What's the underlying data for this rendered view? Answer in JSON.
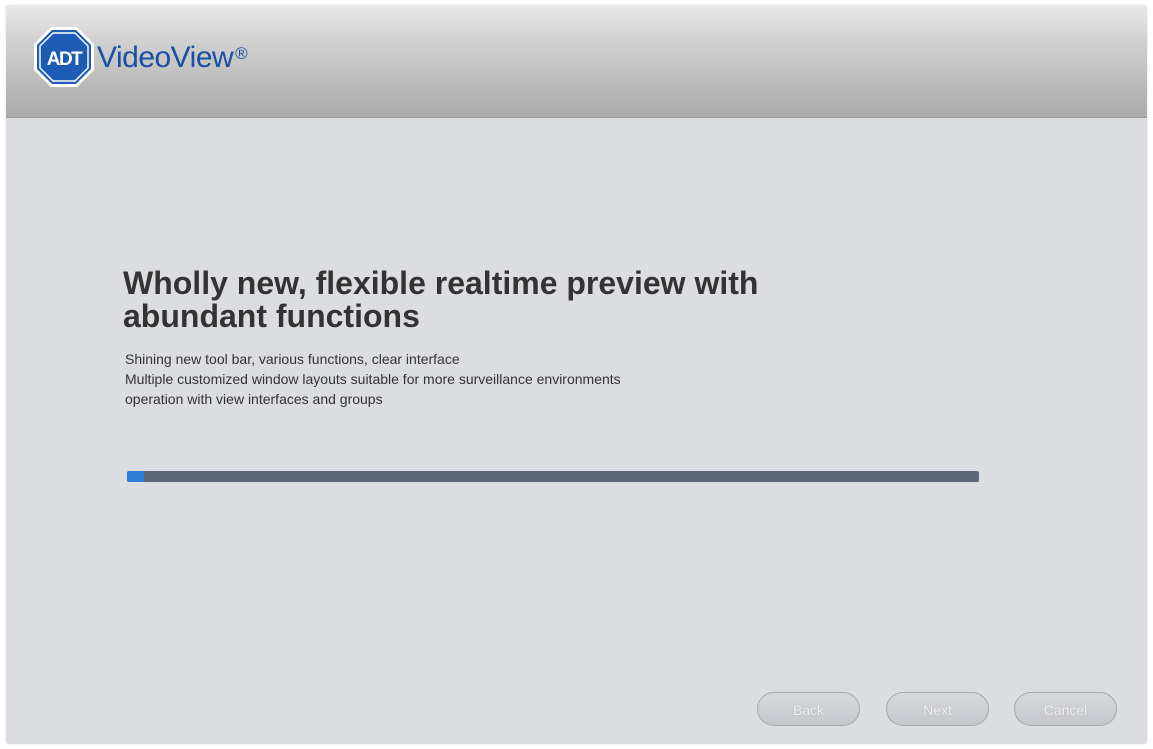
{
  "header": {
    "logo_text": "ADT",
    "brand_name": "VideoView",
    "brand_mark": "®",
    "colors": {
      "brand_blue": "#1a4fa3",
      "logo_blue": "#1e5bb5"
    }
  },
  "content": {
    "headline": "Wholly new, flexible realtime preview with abundant functions",
    "description_lines": [
      "Shining new tool bar, various functions, clear interface",
      "Multiple customized window layouts suitable for more surveillance environments",
      "operation with view interfaces and groups"
    ]
  },
  "progress": {
    "fraction": 0.02,
    "colors": {
      "fill": "#2c7fd8",
      "track": "#5f6675"
    }
  },
  "buttons": {
    "back_label": "Back",
    "next_label": "Next",
    "cancel_label": "Cancel"
  }
}
